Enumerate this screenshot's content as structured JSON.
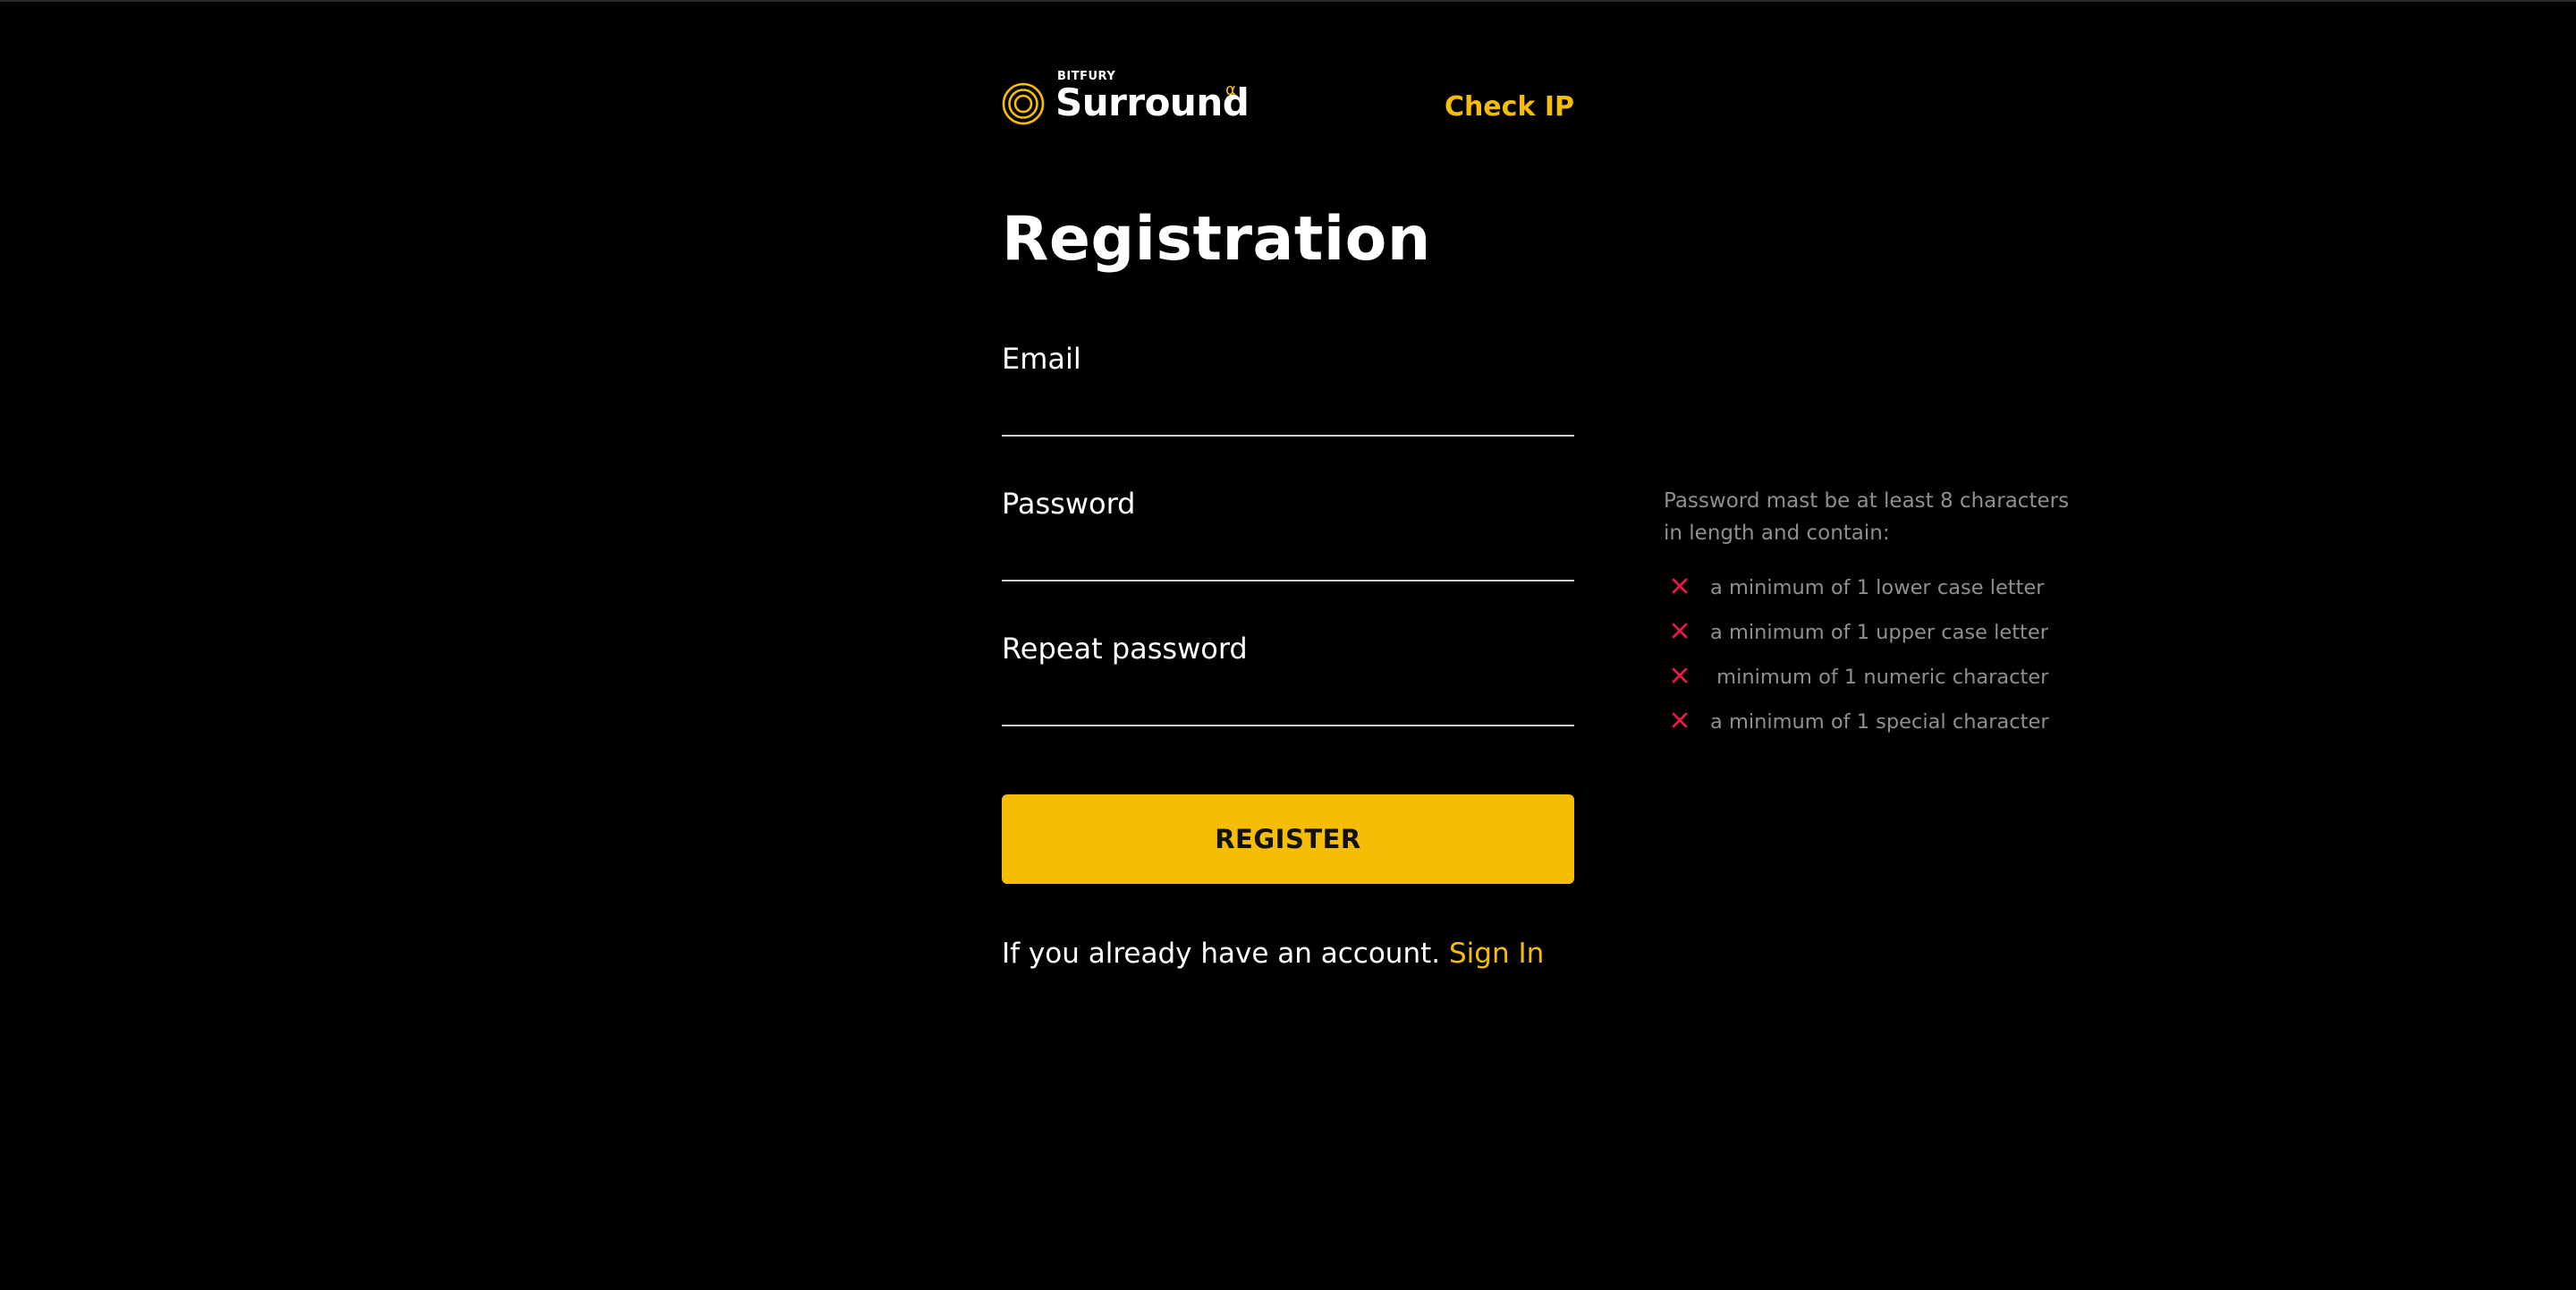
{
  "colors": {
    "background": "#000000",
    "accent": "#f5bd05",
    "error": "#e6194b",
    "muted_text": "#8f8f8f",
    "underline": "#cfcfcf"
  },
  "header": {
    "logo": {
      "brand": "BITFURY",
      "name": "Surround",
      "badge": "α",
      "icon": "concentric-circles-logo-icon"
    },
    "check_ip_label": "Check IP"
  },
  "form": {
    "title": "Registration",
    "email": {
      "label": "Email",
      "value": "",
      "placeholder": ""
    },
    "password": {
      "label": "Password",
      "value": "",
      "placeholder": ""
    },
    "repeat_password": {
      "label": "Repeat password",
      "value": "",
      "placeholder": ""
    },
    "submit_label": "REGISTER",
    "footer": {
      "text": "If you already have an account.",
      "link_label": "Sign In"
    }
  },
  "requirements": {
    "intro": "Password mast be at least 8 characters in length and contain:",
    "items": [
      {
        "icon": "cross-icon",
        "text": "a minimum of 1 lower case letter",
        "met": false
      },
      {
        "icon": "cross-icon",
        "text": "a minimum of 1 upper case letter",
        "met": false
      },
      {
        "icon": "cross-icon",
        "text": " minimum of 1 numeric character",
        "met": false
      },
      {
        "icon": "cross-icon",
        "text": "a minimum of 1 special character",
        "met": false
      }
    ]
  }
}
